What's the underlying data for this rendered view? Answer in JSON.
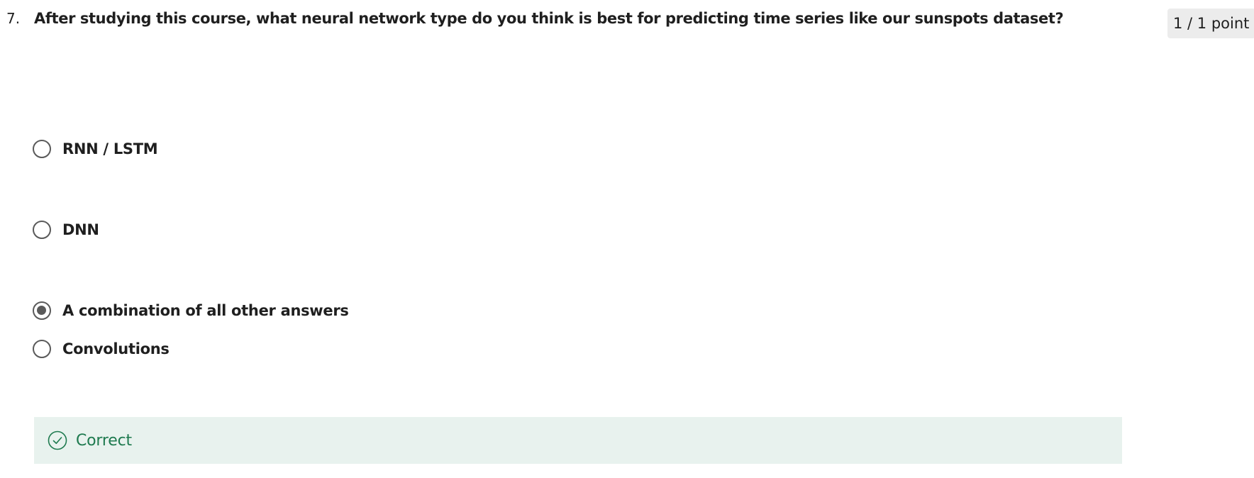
{
  "question": {
    "number": "7.",
    "text": "After studying this course, what neural network type do you think is best for predicting time series like our sunspots dataset?",
    "points": "1 / 1 point"
  },
  "options": [
    {
      "label": "RNN / LSTM",
      "selected": false
    },
    {
      "label": "DNN",
      "selected": false
    },
    {
      "label": "A combination of all other answers",
      "selected": true
    },
    {
      "label": "Convolutions",
      "selected": false
    }
  ],
  "feedback": {
    "status": "Correct",
    "icon": "check-circle-icon",
    "color": "#1e7a4f",
    "background": "#e8f2ee"
  }
}
